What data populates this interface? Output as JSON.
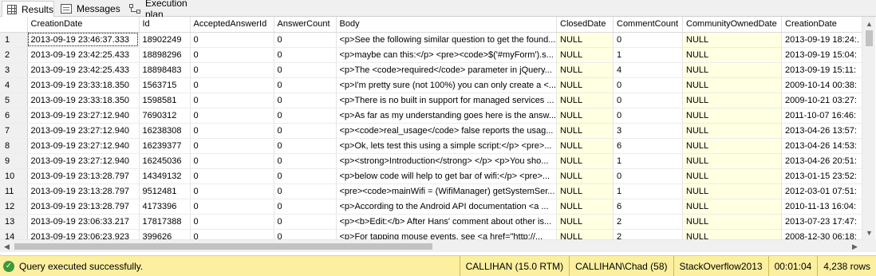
{
  "tabs": [
    {
      "label": "Results",
      "icon": "grid-icon",
      "active": true
    },
    {
      "label": "Messages",
      "icon": "messages-icon",
      "active": false
    },
    {
      "label": "Execution plan",
      "icon": "execution-plan-icon",
      "active": false
    }
  ],
  "grid": {
    "columns": [
      "CreationDate",
      "Id",
      "AcceptedAnswerId",
      "AnswerCount",
      "Body",
      "ClosedDate",
      "CommentCount",
      "CommunityOwnedDate",
      "CreationDate"
    ],
    "rows": [
      [
        "1",
        "2013-09-19 23:46:37.333",
        "18902249",
        "0",
        "0",
        "<p>See the following similar question to get the found...",
        "NULL",
        "0",
        "NULL",
        "2013-09-19 18:24:."
      ],
      [
        "2",
        "2013-09-19 23:42:25.433",
        "18898296",
        "0",
        "0",
        "<p>maybe can this:</p>   <pre><code>$('#myForm').s...",
        "NULL",
        "1",
        "NULL",
        "2013-09-19 15:04:"
      ],
      [
        "3",
        "2013-09-19 23:42:25.433",
        "18898483",
        "0",
        "0",
        "<p>The <code>required</code> parameter in jQuery...",
        "NULL",
        "4",
        "NULL",
        "2013-09-19 15:11:"
      ],
      [
        "4",
        "2013-09-19 23:33:18.350",
        "1563715",
        "0",
        "0",
        "<p>I'm pretty sure (not 100%) you can only create a <...",
        "NULL",
        "0",
        "NULL",
        "2009-10-14 00:38:"
      ],
      [
        "5",
        "2013-09-19 23:33:18.350",
        "1598581",
        "0",
        "0",
        "<p>There is no built in support for managed services ...",
        "NULL",
        "0",
        "NULL",
        "2009-10-21 03:27:"
      ],
      [
        "6",
        "2013-09-19 23:27:12.940",
        "7690312",
        "0",
        "0",
        "<p>As far as my understanding goes here is the answ...",
        "NULL",
        "0",
        "NULL",
        "2011-10-07 16:46:"
      ],
      [
        "7",
        "2013-09-19 23:27:12.940",
        "16238308",
        "0",
        "0",
        "<p><code>real_usage</code> false reports the usag...",
        "NULL",
        "3",
        "NULL",
        "2013-04-26 13:57:"
      ],
      [
        "8",
        "2013-09-19 23:27:12.940",
        "16239377",
        "0",
        "0",
        "<p>Ok, lets test this using a simple script:</p>   <pre>...",
        "NULL",
        "6",
        "NULL",
        "2013-04-26 14:53:"
      ],
      [
        "9",
        "2013-09-19 23:27:12.940",
        "16245036",
        "0",
        "0",
        "<p><strong>Introduction</strong> </p>   <p>You sho...",
        "NULL",
        "1",
        "NULL",
        "2013-04-26 20:51:"
      ],
      [
        "10",
        "2013-09-19 23:13:28.797",
        "14349132",
        "0",
        "0",
        "<p>below code will help to get bar of wifi:</p>   <pre>...",
        "NULL",
        "0",
        "NULL",
        "2013-01-15 23:52:"
      ],
      [
        "11",
        "2013-09-19 23:13:28.797",
        "9512481",
        "0",
        "0",
        "<pre><code>mainWifi = (WifiManager) getSystemSer...",
        "NULL",
        "1",
        "NULL",
        "2012-03-01 07:51:"
      ],
      [
        "12",
        "2013-09-19 23:13:28.797",
        "4173396",
        "0",
        "0",
        "<p>According to the Android API documentation <a ...",
        "NULL",
        "6",
        "NULL",
        "2010-11-13 16:04:"
      ],
      [
        "13",
        "2013-09-19 23:06:33.217",
        "17817388",
        "0",
        "0",
        "<p><b>Edit:</b> After Hans' comment about other is...",
        "NULL",
        "2",
        "NULL",
        "2013-07-23 17:47:"
      ],
      [
        "14",
        "2013-09-19 23:06:23.923",
        "399626",
        "0",
        "0",
        "<p>For tapping mouse events, see <a href=\"http://...",
        "NULL",
        "2",
        "NULL",
        "2008-12-30 06:18:"
      ]
    ]
  },
  "status": {
    "message": "Query executed successfully.",
    "server": "CALLIHAN (15.0 RTM)",
    "user": "CALLIHAN\\Chad (58)",
    "database": "StackOverflow2013",
    "elapsed": "00:01:04",
    "rows": "4,238 rows",
    "background_color": "#fcf0a0",
    "success_color": "#3a9a3a"
  },
  "colors": {
    "null_cell": "#ffffe1",
    "row_header": "#f0f0f0"
  }
}
